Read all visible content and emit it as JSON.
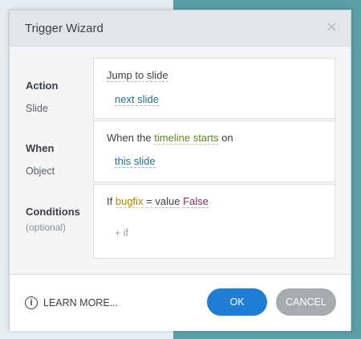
{
  "dialog": {
    "title": "Trigger Wizard",
    "close_glyph": "×"
  },
  "action": {
    "label": "Action",
    "sub_label": "Slide",
    "value": "Jump to slide",
    "target": "next slide"
  },
  "when": {
    "label": "When",
    "sub_label": "Object",
    "prefix": "When the",
    "event": "timeline starts",
    "suffix": "on",
    "object": "this slide"
  },
  "conditions": {
    "label": "Conditions",
    "optional": "(optional)",
    "if_word": "If",
    "variable": "bugfix",
    "operator": "=",
    "value_word": "value",
    "value": "False",
    "add_if": "+ if"
  },
  "footer": {
    "learn_more": "LEARN MORE...",
    "info_glyph": "i",
    "ok": "OK",
    "cancel": "CANCEL"
  },
  "colors": {
    "ok_button": "#1f7ed4",
    "cancel_button": "#a6abaf",
    "link_blue": "#1f6f97",
    "event_green": "#5f8a17",
    "variable_orange": "#b58600",
    "value_purple": "#7e2c6a",
    "background_teal": "#5a9ea8"
  },
  "icons": {
    "close": "close-icon",
    "info": "info-icon"
  }
}
